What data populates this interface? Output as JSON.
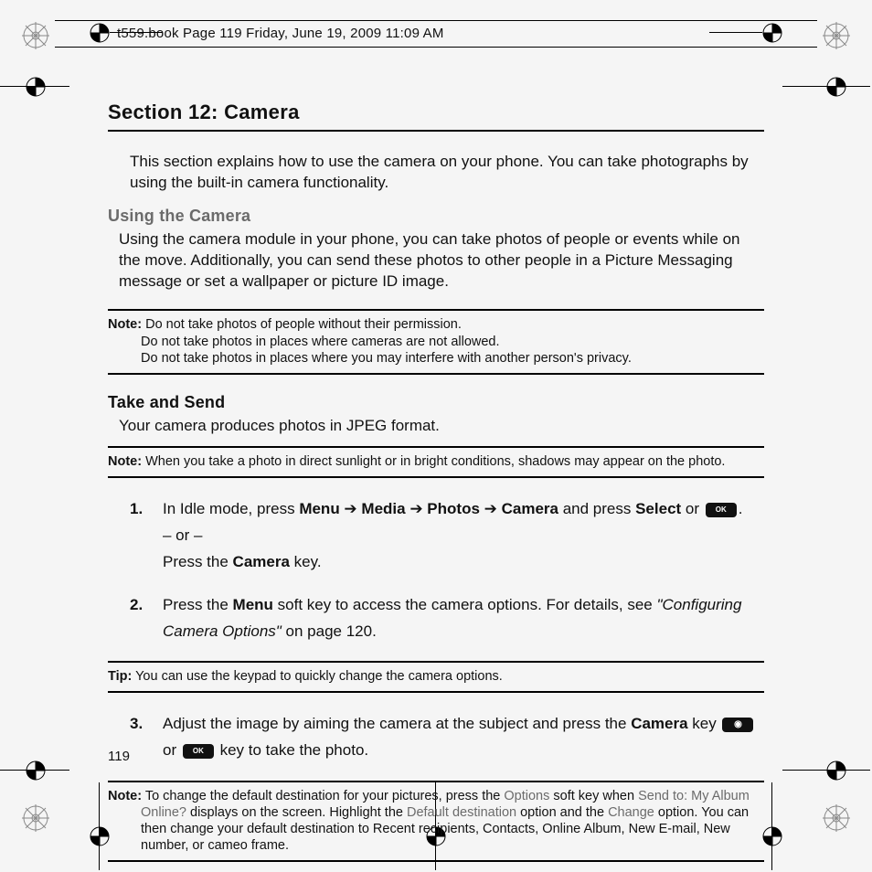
{
  "header_meta": "t559.book  Page 119  Friday, June 19, 2009  11:09 AM",
  "section_title": "Section 12: Camera",
  "intro": "This section explains how to use the camera on your phone. You can take photographs by using the built-in camera functionality.",
  "using_heading": "Using the Camera",
  "using_body": "Using the camera module in your phone, you can take photos of people or events while on the move. Additionally, you can send these photos to other people in a Picture Messaging message or set a wallpaper or picture ID image.",
  "note1": {
    "label": "Note:",
    "l1": "Do not take photos of people without their permission.",
    "l2": "Do not take photos in places where cameras are not allowed.",
    "l3": "Do not take photos in places where you may interfere with another person's privacy."
  },
  "take_heading": "Take and Send",
  "take_body": "Your camera produces photos in JPEG format.",
  "note2": {
    "label": "Note:",
    "text": "When you take a photo in direct sunlight or in bright conditions, shadows may appear on the photo."
  },
  "steps": {
    "s1a": "In Idle mode, press ",
    "menu": "Menu",
    "arrow": " ➔ ",
    "media": "Media",
    "photos": "Photos",
    "camera": "Camera",
    "s1b": " and press ",
    "select": "Select",
    "s1c": " or ",
    "okkey": "OK",
    "s1d": ".",
    "or": "– or –",
    "s1e_a": "Press the ",
    "camerakey": "Camera",
    "s1e_b": " key.",
    "s2a": "Press the ",
    "s2menu": "Menu",
    "s2b": " soft key to access the camera options. For details, see ",
    "s2ref": "\"Configuring Camera Options\"",
    "s2c": " on page 120."
  },
  "tip": {
    "label": "Tip:",
    "text": "You can use the keypad to quickly change the camera options."
  },
  "step3": {
    "a": "Adjust the image by aiming the camera at the subject and press the ",
    "cam": "Camera",
    "b": " key ",
    "c": " or ",
    "ok": "OK",
    "d": " key to take the photo."
  },
  "note3": {
    "label": "Note:",
    "a": "To change the default destination for your pictures, press the ",
    "options": "Options",
    "b": " soft key when ",
    "sendto": "Send to: My Album Online?",
    "c": " displays on the screen. Highlight the ",
    "dd": "Default destination",
    "d": " option and the ",
    "change": "Change",
    "e": " option. You can then change your default destination to Recent recipients, Contacts, Online Album, New E-mail, New number, or cameo frame."
  },
  "page_number": "119"
}
